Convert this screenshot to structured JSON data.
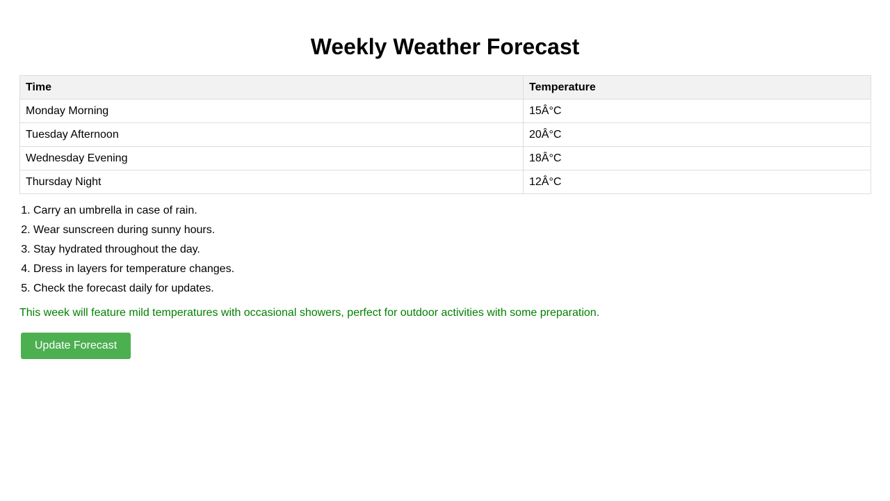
{
  "page": {
    "title": "Weekly Weather Forecast"
  },
  "table": {
    "headers": [
      "Time",
      "Temperature"
    ],
    "rows": [
      [
        "Monday Morning",
        "15Â°C"
      ],
      [
        "Tuesday Afternoon",
        "20Â°C"
      ],
      [
        "Wednesday Evening",
        "18Â°C"
      ],
      [
        "Thursday Night",
        "12Â°C"
      ]
    ]
  },
  "tips": [
    "Carry an umbrella in case of rain.",
    "Wear sunscreen during sunny hours.",
    "Stay hydrated throughout the day.",
    "Dress in layers for temperature changes.",
    "Check the forecast daily for updates."
  ],
  "summary": "This week will feature mild temperatures with occasional showers, perfect for outdoor activities with some preparation.",
  "button": {
    "label": "Update Forecast"
  },
  "colors": {
    "summary_text": "#008000",
    "button_bg": "#4CAF50",
    "button_text": "#ffffff",
    "header_bg": "#f2f2f2",
    "border": "#dddddd"
  }
}
